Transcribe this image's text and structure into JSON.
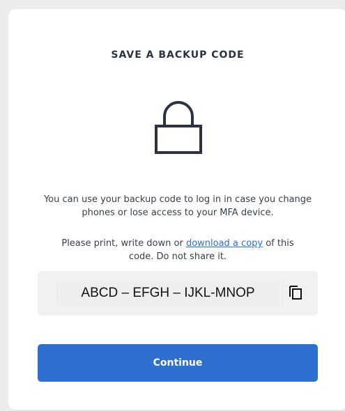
{
  "dialog": {
    "title": "SAVE A BACKUP CODE",
    "description": "You can use your backup code to log in in case you change phones or lose access to your MFA device.",
    "instruction_before": "Please print, write down or ",
    "download_link": "download a copy",
    "instruction_after": " of this code. Do not share it.",
    "backup_code": "ABCD – EFGH – IJKL-MNOP",
    "continue_label": "Continue"
  },
  "icons": {
    "lock": "lock-icon",
    "copy": "copy-icon"
  },
  "colors": {
    "accent": "#2f6fd0",
    "link": "#2b6fd6",
    "title": "#2b3240",
    "icon": "#2b3240"
  }
}
